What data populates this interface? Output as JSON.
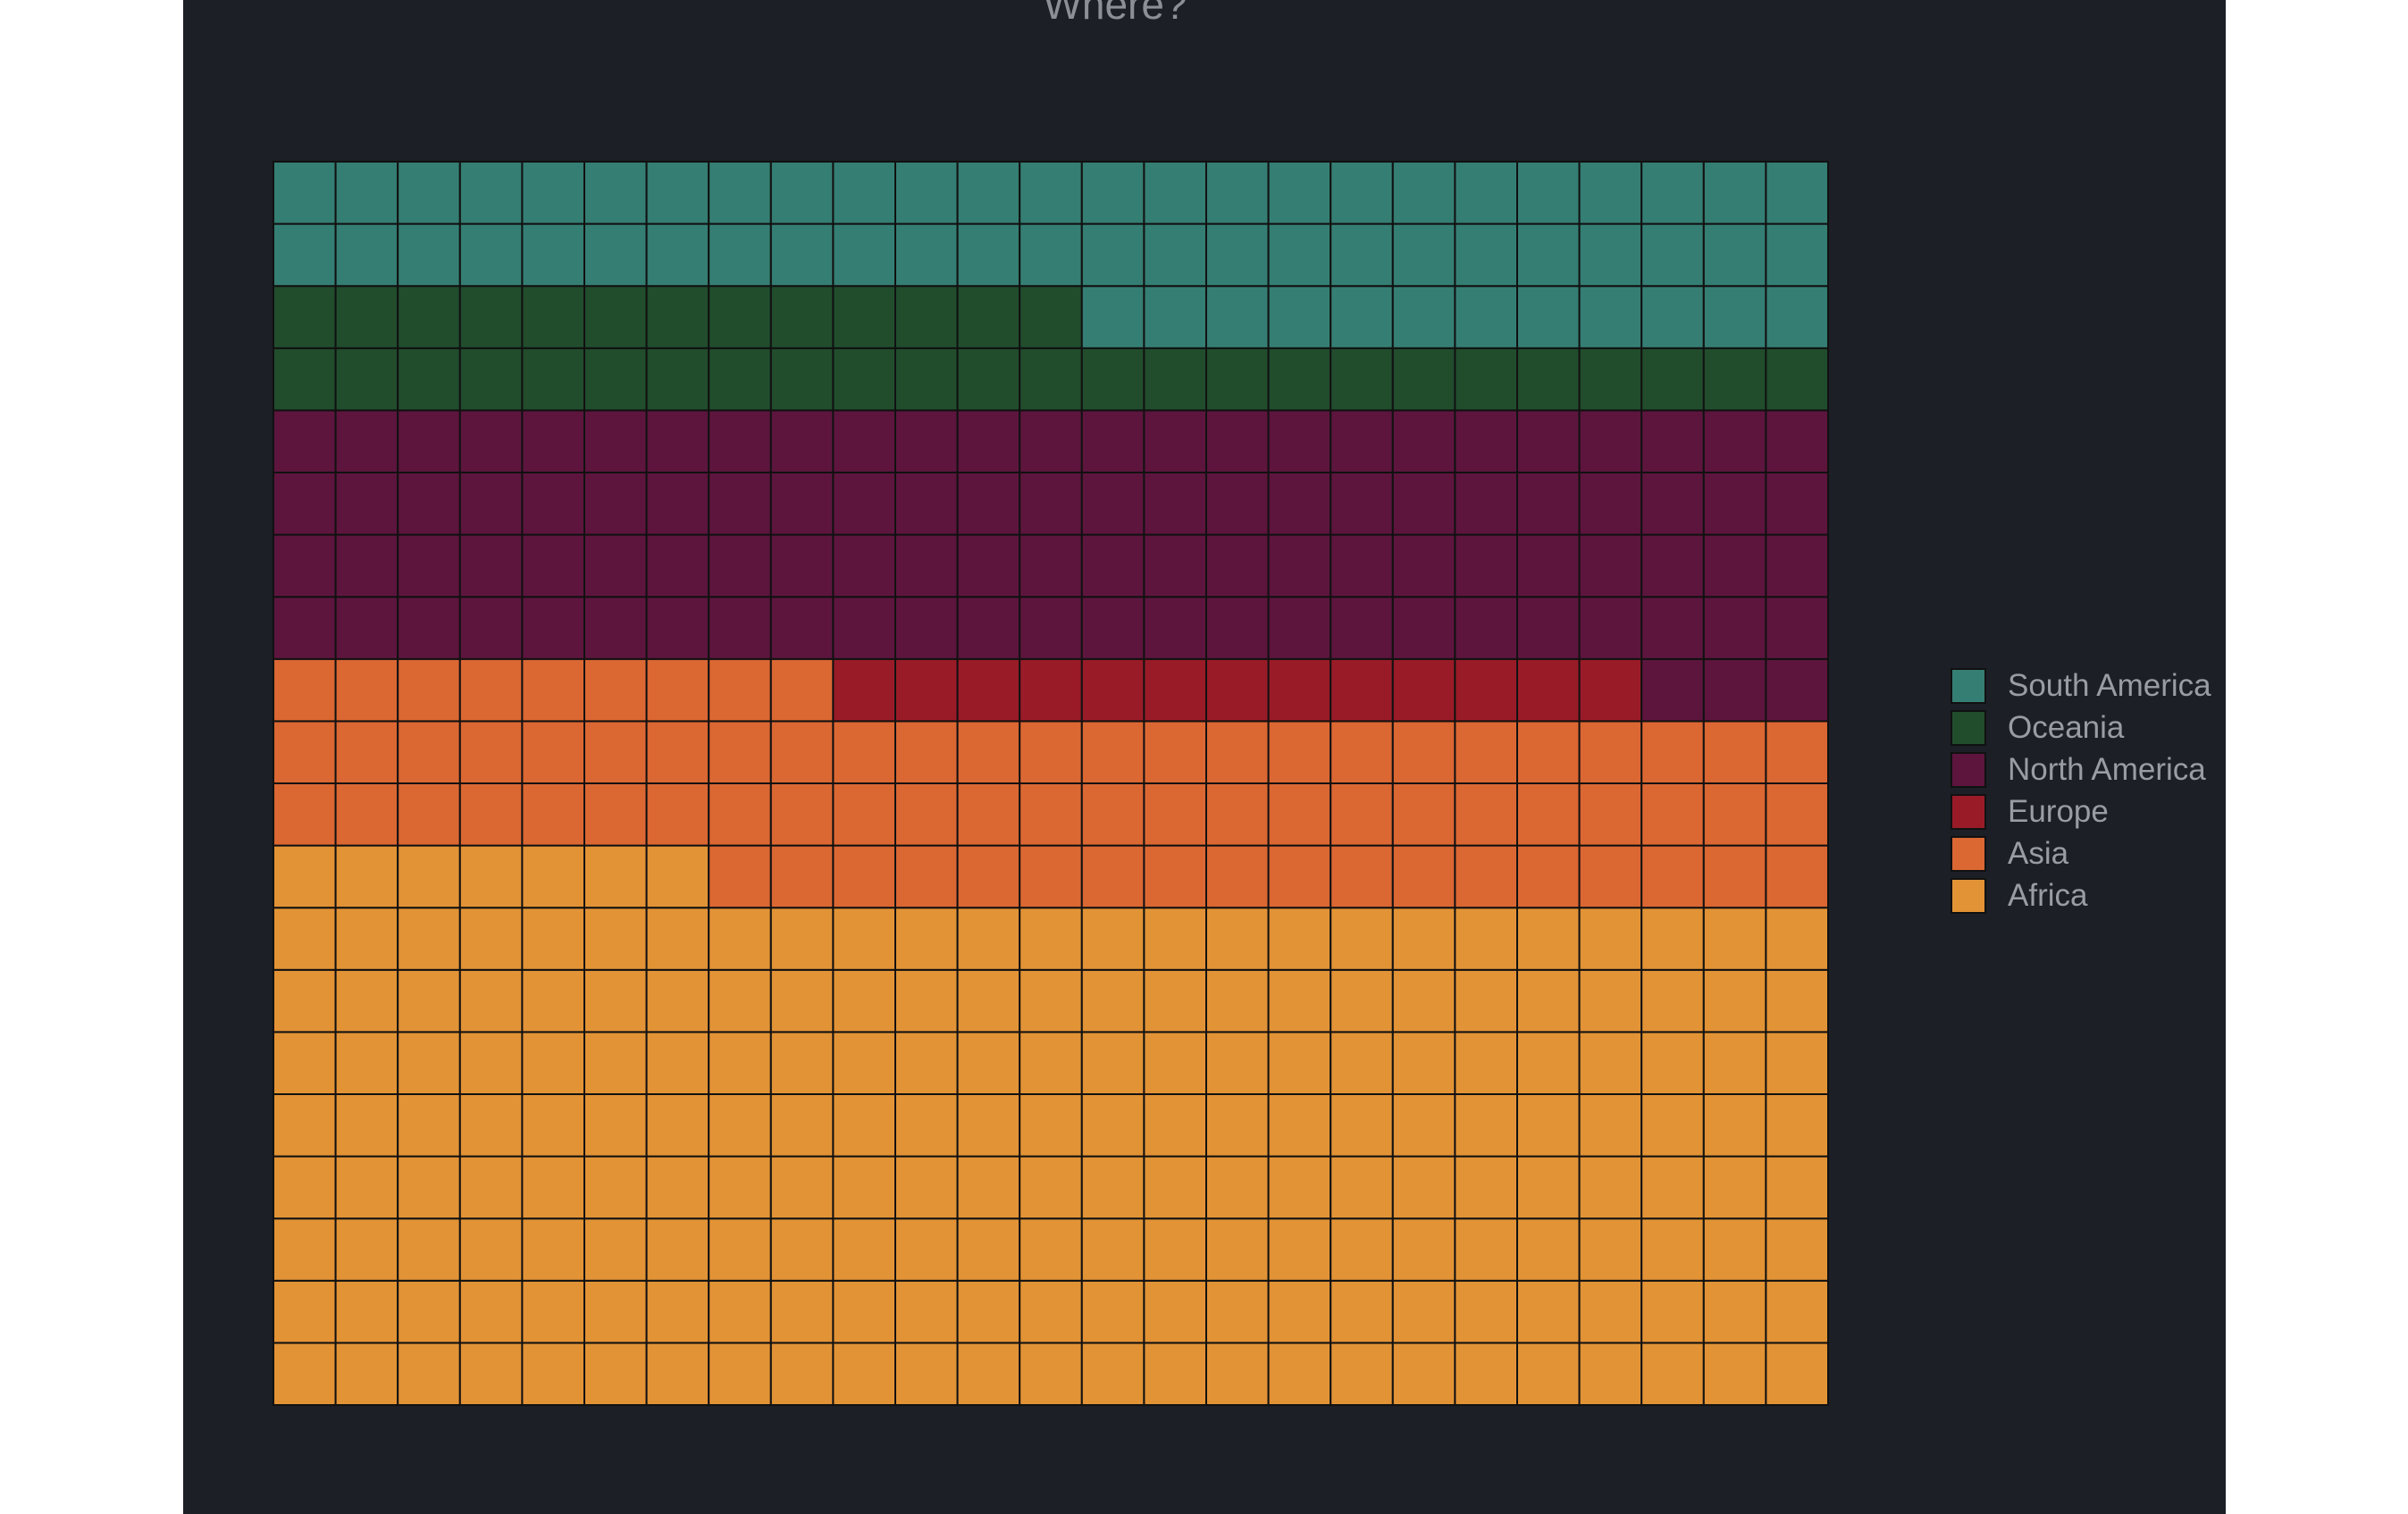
{
  "chart_data": {
    "type": "waffle",
    "title": "Where?",
    "grid": {
      "rows": 20,
      "columns": 25,
      "fill_order": "rows, bottom-left to top-right"
    },
    "unit": "squares",
    "categories": [
      "Africa",
      "Asia",
      "Europe",
      "North America",
      "Oceania",
      "South America"
    ],
    "values": [
      207,
      77,
      13,
      103,
      38,
      62
    ],
    "colors": [
      "#e29336",
      "#db6733",
      "#9a1b28",
      "#5d153e",
      "#214d2d",
      "#357e73"
    ],
    "legend": {
      "placement": "right",
      "order": [
        "South America",
        "Oceania",
        "North America",
        "Europe",
        "Asia",
        "Africa"
      ]
    }
  }
}
